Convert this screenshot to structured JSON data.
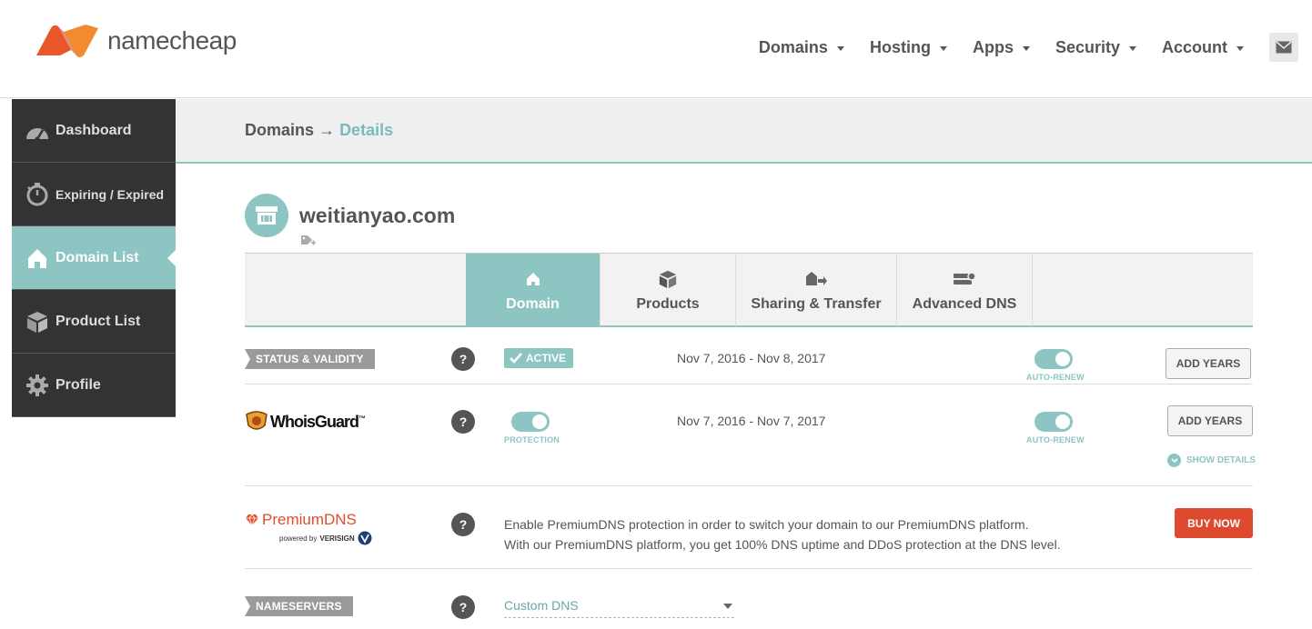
{
  "brand": {
    "name": "namecheap",
    "accent": "#8cc5c2",
    "logo_color": "#e8562a"
  },
  "topnav": {
    "items": [
      {
        "label": "Domains"
      },
      {
        "label": "Hosting"
      },
      {
        "label": "Apps"
      },
      {
        "label": "Security"
      },
      {
        "label": "Account"
      }
    ],
    "mail_icon": "envelope-icon"
  },
  "sidebar": {
    "items": [
      {
        "label": "Dashboard",
        "icon": "gauge-icon"
      },
      {
        "label": "Expiring / Expired",
        "icon": "stopwatch-icon"
      },
      {
        "label": "Domain List",
        "icon": "home-icon",
        "active": true
      },
      {
        "label": "Product List",
        "icon": "box-icon"
      },
      {
        "label": "Profile",
        "icon": "gear-icon"
      }
    ]
  },
  "breadcrumb": {
    "parent": "Domains",
    "separator": "→",
    "current": "Details"
  },
  "domain": {
    "name": "weitianyao.com",
    "icon": "storefront-icon",
    "tag_icon": "tag-plus-icon"
  },
  "tabs": [
    {
      "label": "Domain",
      "icon": "home-icon",
      "active": true
    },
    {
      "label": "Products",
      "icon": "box-icon"
    },
    {
      "label": "Sharing & Transfer",
      "icon": "truck-icon"
    },
    {
      "label": "Advanced DNS",
      "icon": "server-icon"
    }
  ],
  "status_row": {
    "label": "STATUS & VALIDITY",
    "help": "?",
    "status": "ACTIVE",
    "dates": "Nov 7, 2016 - Nov 8, 2017",
    "autorenew_label": "AUTO-RENEW",
    "button": "ADD YEARS"
  },
  "whoisguard_row": {
    "logo_text": "WhoisGuard",
    "logo_tm": "™",
    "help": "?",
    "protection_label": "PROTECTION",
    "dates": "Nov 7, 2016 - Nov 7, 2017",
    "autorenew_label": "AUTO-RENEW",
    "button": "ADD YEARS",
    "show_details": "SHOW DETAILS"
  },
  "premiumdns_row": {
    "logo_text": "PremiumDNS",
    "powered_by": "powered by",
    "verisign": "VERISIGN",
    "help": "?",
    "desc_line1": "Enable PremiumDNS protection in order to switch your domain to our PremiumDNS platform.",
    "desc_line2": "With our PremiumDNS platform, you get 100% DNS uptime and DDoS protection at the DNS level.",
    "button": "BUY NOW"
  },
  "nameservers_row": {
    "label": "NAMESERVERS",
    "help": "?",
    "selected": "Custom DNS"
  }
}
